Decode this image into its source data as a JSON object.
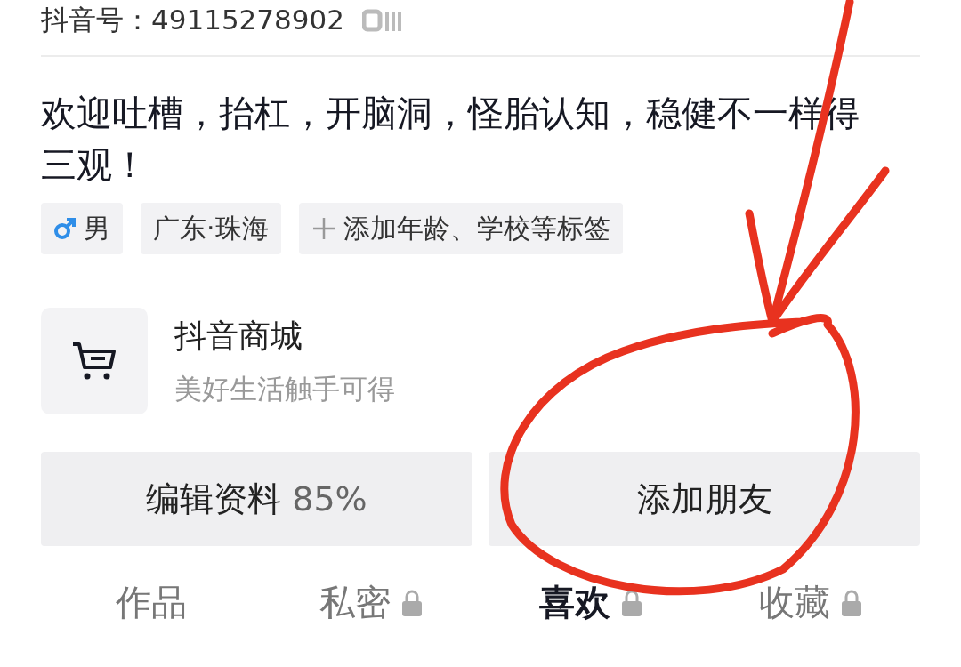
{
  "account_id": {
    "label": "抖音号：49115278902"
  },
  "bio": "欢迎吐槽，抬杠，开脑洞，怪胎认知，稳健不一样得三观！",
  "tags": [
    {
      "kind": "gender",
      "label": "男"
    },
    {
      "kind": "plain",
      "label": "广东·珠海"
    },
    {
      "kind": "add",
      "label": "添加年龄、学校等标签"
    }
  ],
  "shop": {
    "title": "抖音商城",
    "subtitle": "美好生活触手可得"
  },
  "buttons": [
    {
      "label": "编辑资料",
      "extra": "85%"
    },
    {
      "label": "添加朋友"
    }
  ],
  "tabs": [
    {
      "label": "作品",
      "selected": false,
      "locked": false
    },
    {
      "label": "私密",
      "selected": false,
      "locked": true
    },
    {
      "label": "喜欢",
      "selected": true,
      "locked": true
    },
    {
      "label": "收藏",
      "selected": false,
      "locked": true
    }
  ]
}
